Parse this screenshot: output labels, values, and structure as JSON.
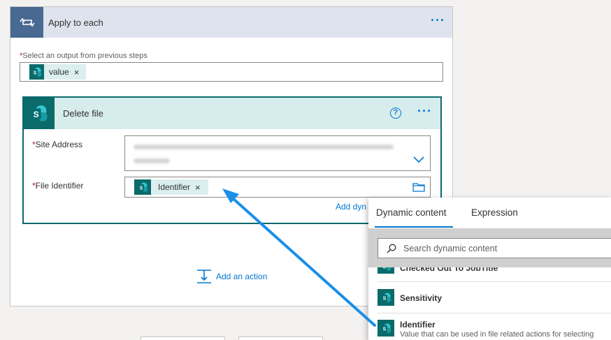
{
  "apply_to_each": {
    "title": "Apply to each",
    "select_label": "Select an output from previous steps",
    "required_mark": "*",
    "token": "value",
    "remove": "×",
    "more": "···"
  },
  "delete_file": {
    "title": "Delete file",
    "help": "?",
    "more": "···",
    "site_address": {
      "required_mark": "*",
      "label": "Site Address"
    },
    "file_identifier": {
      "required_mark": "*",
      "label": "File Identifier",
      "token": "Identifier",
      "remove": "×"
    },
    "add_dynamic": "Add dynamic content"
  },
  "add_action": "Add an action",
  "dynamic_panel": {
    "tabs": [
      "Dynamic content",
      "Expression"
    ],
    "active_tab": "Dynamic content",
    "search_placeholder": "Search dynamic content",
    "items": [
      {
        "name": "Checked Out To JobTitle",
        "description": ""
      },
      {
        "name": "Sensitivity",
        "description": ""
      },
      {
        "name": "Identifier",
        "description": "Value that can be used in file related actions for selecting"
      }
    ]
  },
  "colors": {
    "accent": "#0078d4",
    "sharepoint": "#0b6a6a",
    "loop_header": "#486991",
    "annotation_arrow": "#1a8fe8"
  }
}
